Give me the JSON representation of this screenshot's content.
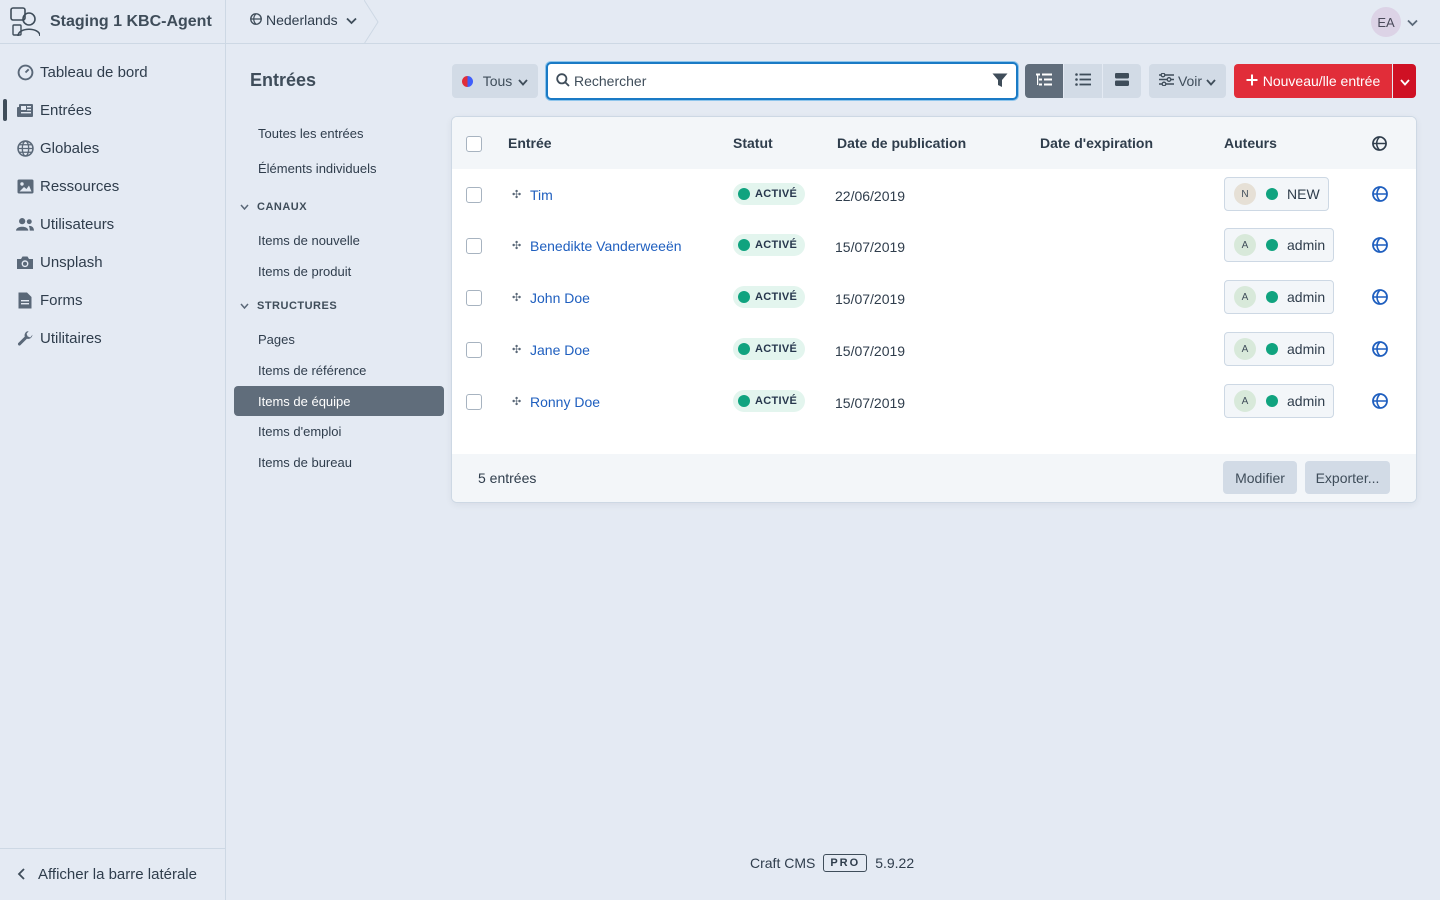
{
  "app": {
    "site_name": "Staging 1 KBC-Agent"
  },
  "nav": {
    "items": [
      {
        "label": "Tableau de bord",
        "icon": "gauge-icon"
      },
      {
        "label": "Entrées",
        "icon": "newspaper-icon",
        "active": true
      },
      {
        "label": "Globales",
        "icon": "globe-icon"
      },
      {
        "label": "Ressources",
        "icon": "image-icon"
      },
      {
        "label": "Utilisateurs",
        "icon": "users-icon"
      },
      {
        "label": "Unsplash",
        "icon": "camera-icon"
      },
      {
        "label": "Forms",
        "icon": "file-icon"
      },
      {
        "label": "Utilitaires",
        "icon": "wrench-icon"
      }
    ],
    "collapse_label": "Afficher la barre latérale"
  },
  "header": {
    "site_language": "Nederlands",
    "user_initials": "EA"
  },
  "page": {
    "title": "Entrées"
  },
  "sources": {
    "all": "Toutes les entrées",
    "singles": "Éléments individuels",
    "channels_heading": "CANAUX",
    "channels": [
      "Items de nouvelle",
      "Items de produit"
    ],
    "structures_heading": "STRUCTURES",
    "structures": [
      "Pages",
      "Items de référence",
      "Items de équipe",
      "Items d'emploi",
      "Items de bureau"
    ],
    "selected": "Items de équipe"
  },
  "toolbar": {
    "status_filter": "Tous",
    "search_placeholder": "Rechercher",
    "view_label": "Voir",
    "new_entry_label": "Nouveau/lle entrée"
  },
  "table": {
    "columns": [
      "Entrée",
      "Statut",
      "Date de publication",
      "Date d'expiration",
      "Auteurs"
    ],
    "rows": [
      {
        "title": "Tim",
        "status": "ACTIVÉ",
        "post_date": "22/06/2019",
        "expiry_date": "",
        "author_initial": "N",
        "author": "NEW"
      },
      {
        "title": "Benedikte Vanderweeën",
        "status": "ACTIVÉ",
        "post_date": "15/07/2019",
        "expiry_date": "",
        "author_initial": "A",
        "author": "admin"
      },
      {
        "title": "John Doe",
        "status": "ACTIVÉ",
        "post_date": "15/07/2019",
        "expiry_date": "",
        "author_initial": "A",
        "author": "admin"
      },
      {
        "title": "Jane Doe",
        "status": "ACTIVÉ",
        "post_date": "15/07/2019",
        "expiry_date": "",
        "author_initial": "A",
        "author": "admin"
      },
      {
        "title": "Ronny Doe",
        "status": "ACTIVÉ",
        "post_date": "15/07/2019",
        "expiry_date": "",
        "author_initial": "A",
        "author": "admin"
      }
    ],
    "count_label": "5 entrées",
    "edit_label": "Modifier",
    "export_label": "Exporter..."
  },
  "footer": {
    "product": "Craft CMS",
    "edition": "PRO",
    "version": "5.9.22"
  },
  "colors": {
    "accent": "#e12d39",
    "link": "#1f5fbf",
    "enabled": "#10a37f",
    "focus": "#1a7ac5"
  }
}
